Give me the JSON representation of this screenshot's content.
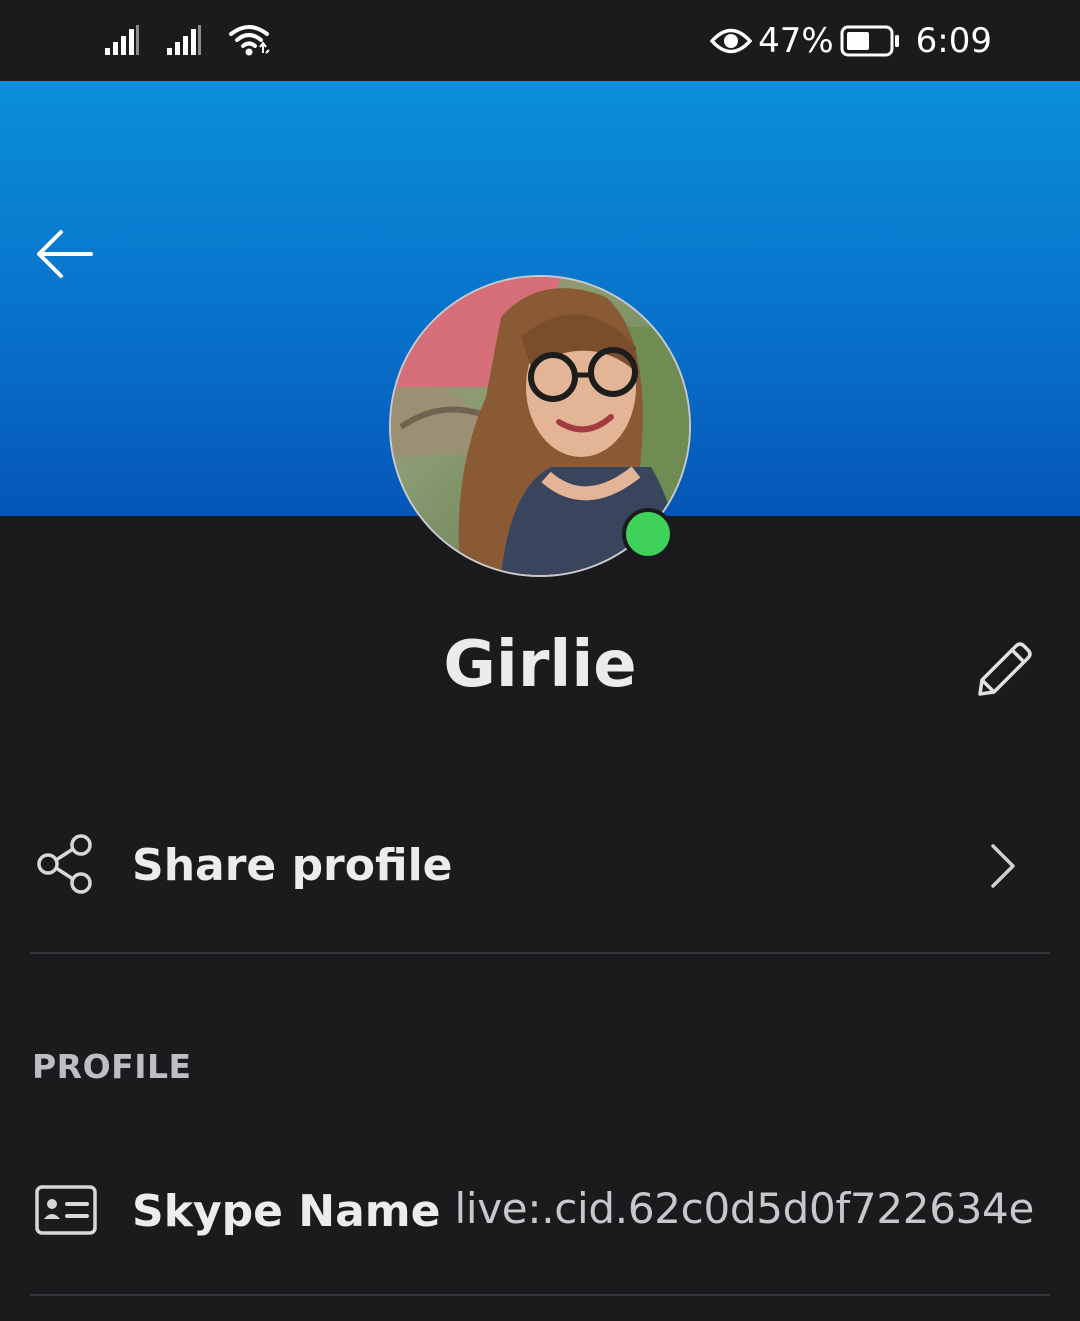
{
  "status_bar": {
    "battery_percent": "47%",
    "time": "6:09",
    "icons": [
      "signal-icon",
      "signal-icon",
      "wifi-icon",
      "eye-icon",
      "battery-icon"
    ]
  },
  "header": {
    "back_icon": "arrow-left-icon",
    "gradient_top": "#0a8fdb",
    "gradient_bottom": "#0556b6"
  },
  "profile": {
    "name": "Girlie",
    "presence": "online",
    "presence_color": "#3fd15a",
    "edit_icon": "pencil-icon"
  },
  "share": {
    "label": "Share profile",
    "icon": "share-icon",
    "chevron_icon": "chevron-right-icon"
  },
  "section": {
    "title": "PROFILE"
  },
  "skype_name": {
    "label": "Skype Name",
    "value": "live:.cid.62c0d5d0f722634e",
    "icon": "id-card-icon"
  }
}
